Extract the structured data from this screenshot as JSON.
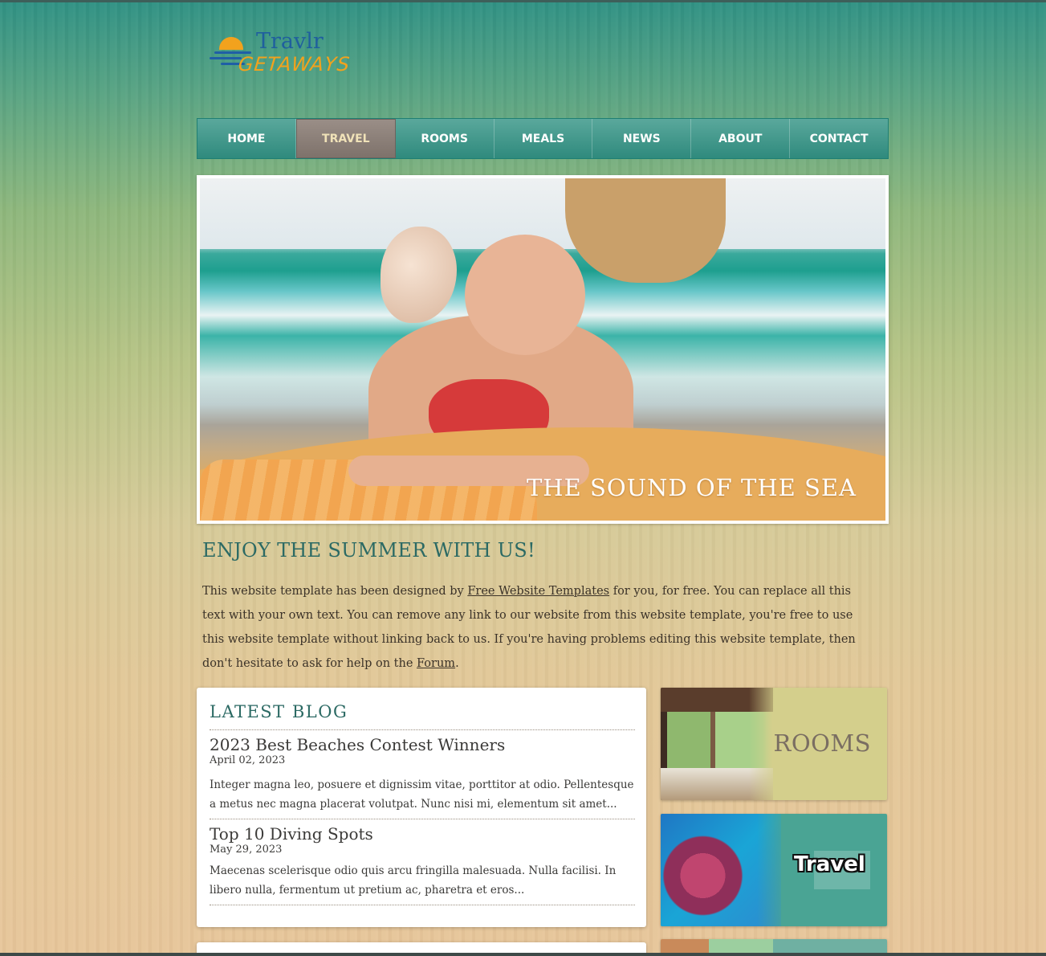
{
  "logo": {
    "name": "Travlr",
    "tagline": "GETAWAYS"
  },
  "nav": {
    "items": [
      {
        "label": "HOME"
      },
      {
        "label": "TRAVEL"
      },
      {
        "label": "ROOMS"
      },
      {
        "label": "MEALS"
      },
      {
        "label": "NEWS"
      },
      {
        "label": "ABOUT"
      },
      {
        "label": "CONTACT"
      }
    ],
    "active": "TRAVEL"
  },
  "hero": {
    "caption": "THE SOUND OF THE SEA"
  },
  "intro": {
    "title": "ENJOY THE SUMMER WITH US!",
    "text_1": "This website template has been designed by ",
    "link_1": "Free Website Templates",
    "text_2": " for you, for free. You can replace all this text with your own text. You can remove any link to our website from this website template, you're free to use this website template without linking back to us. If you're having problems editing this website template, then don't hesitate to ask for help on the ",
    "link_2": "Forum",
    "text_3": "."
  },
  "blog": {
    "title": "LATEST BLOG",
    "posts": [
      {
        "title": "2023 Best Beaches Contest Winners",
        "date": "April 02, 2023",
        "excerpt": "Integer magna leo, posuere et dignissim vitae, porttitor at odio. Pellentesque a metus nec magna placerat volutpat. Nunc nisi mi, elementum sit amet..."
      },
      {
        "title": "Top 10 Diving Spots",
        "date": "May 29, 2023",
        "excerpt": "Maecenas scelerisque odio quis arcu fringilla malesuada. Nulla facilisi. In libero nulla, fermentum ut pretium ac, pharetra et eros..."
      }
    ]
  },
  "tiles": {
    "rooms": "ROOMS",
    "travel": "Travel"
  },
  "colors": {
    "nav_bg": "#2f8a7d",
    "nav_active_bg": "#7e726b",
    "heading_teal": "#2c6a64",
    "hero_caption": "#ffffff"
  }
}
